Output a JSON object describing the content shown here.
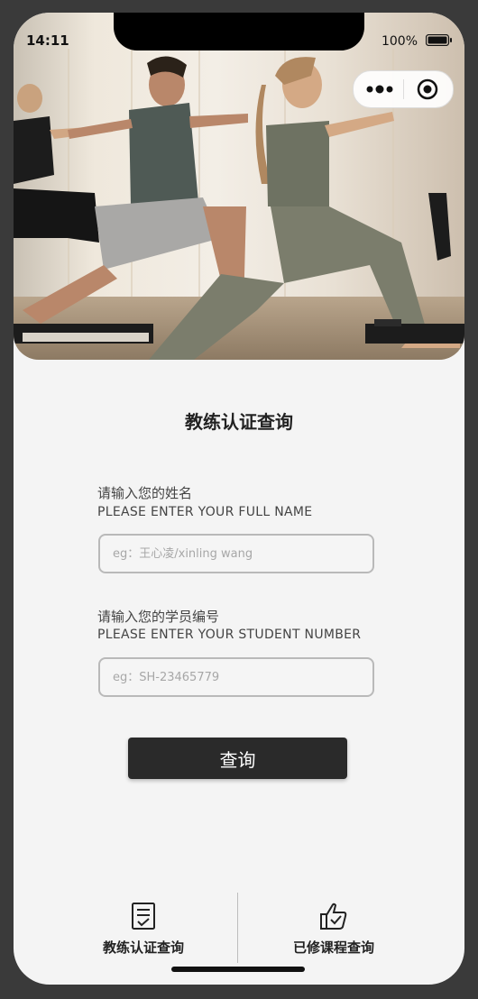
{
  "status_bar": {
    "time": "14:11",
    "battery": "100%"
  },
  "hero": {
    "image_desc": "Pilates class doing lunges on reformer machines"
  },
  "page": {
    "title": "教练认证查询"
  },
  "name_field": {
    "label_cn": "请输入您的姓名",
    "label_en": "PLEASE ENTER YOUR FULL NAME",
    "placeholder": "eg：王心凌/xinling wang",
    "value": ""
  },
  "student_field": {
    "label_cn": "请输入您的学员编号",
    "label_en": "PLEASE ENTER YOUR STUDENT NUMBER",
    "placeholder": "eg：SH-23465779",
    "value": ""
  },
  "query_button": {
    "label": "查询"
  },
  "tabbar": {
    "tabs": [
      {
        "label": "教练认证查询",
        "icon": "checklist-icon"
      },
      {
        "label": "已修课程查询",
        "icon": "thumbs-up-check-icon"
      }
    ]
  },
  "colors": {
    "background": "#f4f4f4",
    "button_bg": "#2a2a2a",
    "input_border": "#b9b9b9",
    "text": "#222222"
  }
}
